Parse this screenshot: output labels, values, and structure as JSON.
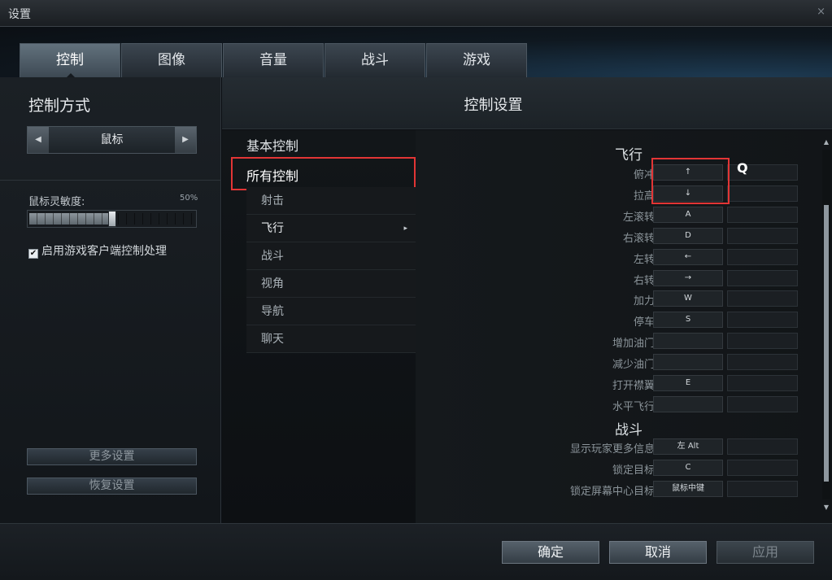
{
  "window": {
    "title": "设置",
    "close_glyph": "×"
  },
  "tabs": [
    {
      "label": "控制",
      "active": true
    },
    {
      "label": "图像"
    },
    {
      "label": "音量"
    },
    {
      "label": "战斗"
    },
    {
      "label": "游戏"
    }
  ],
  "left": {
    "heading": "控制方式",
    "mode_selector": {
      "value": "鼠标",
      "prev_glyph": "◀",
      "next_glyph": "▶"
    },
    "sensitivity": {
      "label": "鼠标灵敏度:",
      "value_text": "50%",
      "level": 0.5
    },
    "client_control": {
      "label": "启用游戏客户端控制处理",
      "checked": true,
      "check_glyph": "✔"
    },
    "more_settings": "更多设置",
    "restore_settings": "恢复设置"
  },
  "main": {
    "header": "控制设置",
    "categories": {
      "basic": "基本控制",
      "all": "所有控制"
    },
    "subcategories": [
      "射击",
      "飞行",
      "战斗",
      "视角",
      "导航",
      "聊天"
    ],
    "active_sub_caret": "▸",
    "sections": {
      "flight": "飞行",
      "combat": "战斗"
    },
    "flight_bindings": [
      {
        "label": "俯冲",
        "key": "↑"
      },
      {
        "label": "拉高",
        "key": "↓"
      },
      {
        "label": "左滚转",
        "key": "A"
      },
      {
        "label": "右滚转",
        "key": "D"
      },
      {
        "label": "左转",
        "key": "←"
      },
      {
        "label": "右转",
        "key": "→"
      },
      {
        "label": "加力",
        "key": "W"
      },
      {
        "label": "停车",
        "key": "S"
      },
      {
        "label": "增加油门",
        "key": ""
      },
      {
        "label": "减少油门",
        "key": ""
      },
      {
        "label": "打开襟翼",
        "key": "E"
      },
      {
        "label": "水平飞行",
        "key": ""
      }
    ],
    "combat_bindings": [
      {
        "label": "显示玩家更多信息",
        "key": "左 Alt"
      },
      {
        "label": "锁定目标",
        "key": "C"
      },
      {
        "label": "锁定屏幕中心目标",
        "key": "鼠标中键"
      }
    ],
    "annotation": "Q",
    "scroll_up": "▲",
    "scroll_down": "▼"
  },
  "footer": {
    "ok": "确定",
    "cancel": "取消",
    "apply": "应用"
  },
  "colors": {
    "highlight_red": "#e23535",
    "accent_blue": "#1d3a52"
  }
}
